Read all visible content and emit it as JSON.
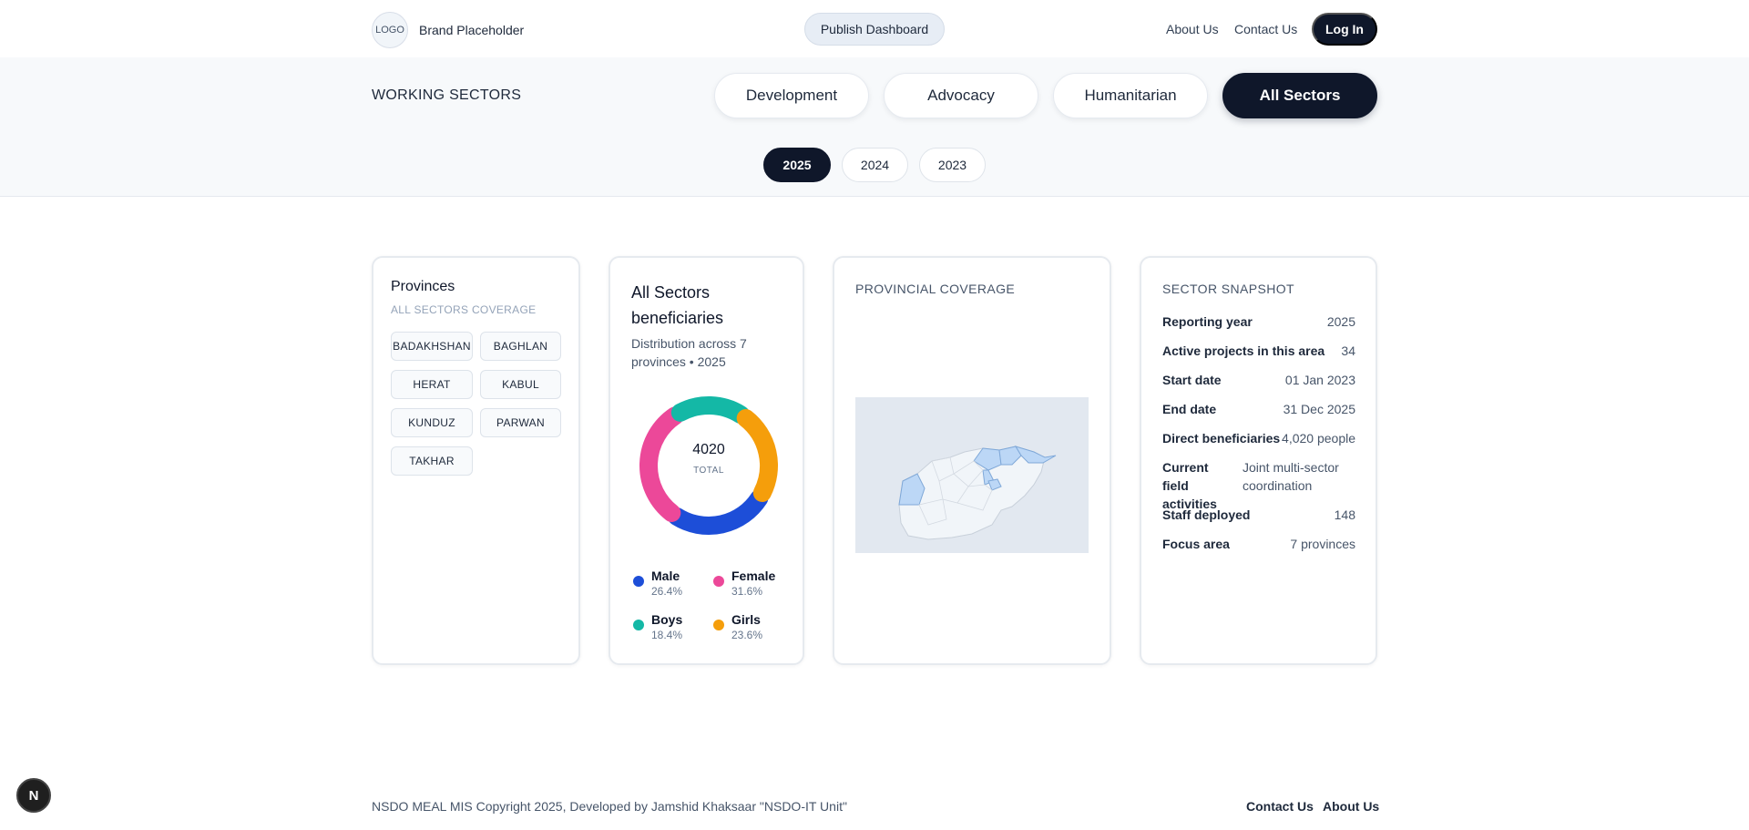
{
  "header": {
    "logo_text": "LOGO",
    "brand_name": "Brand Placeholder",
    "publish_label": "Publish Dashboard",
    "nav": {
      "about": "About Us",
      "contact": "Contact Us"
    },
    "login_label": "Log In"
  },
  "sectors": {
    "title": "WORKING SECTORS",
    "buttons": [
      "Development",
      "Advocacy",
      "Humanitarian",
      "All Sectors"
    ],
    "active": "All Sectors"
  },
  "years": {
    "buttons": [
      "2025",
      "2024",
      "2023"
    ],
    "active": "2025"
  },
  "provinces_card": {
    "title": "Provinces",
    "subtitle": "ALL SECTORS COVERAGE",
    "chips": [
      "BADAKHSHAN",
      "BAGHLAN",
      "HERAT",
      "KABUL",
      "KUNDUZ",
      "PARWAN",
      "TAKHAR"
    ]
  },
  "beneficiaries_card": {
    "title": "All Sectors beneficiaries",
    "subtitle": "Distribution across 7 provinces • 2025",
    "total": "4020",
    "total_label": "TOTAL",
    "legend": [
      {
        "name": "Male",
        "pct": "26.4%",
        "color": "#1d4ed8"
      },
      {
        "name": "Female",
        "pct": "31.6%",
        "color": "#ec4899"
      },
      {
        "name": "Boys",
        "pct": "18.4%",
        "color": "#14b8a6"
      },
      {
        "name": "Girls",
        "pct": "23.6%",
        "color": "#f59e0b"
      }
    ]
  },
  "chart_data": {
    "type": "pie",
    "categories": [
      "Male",
      "Female",
      "Boys",
      "Girls"
    ],
    "values": [
      26.4,
      31.6,
      18.4,
      23.6
    ],
    "total": 4020,
    "colors": [
      "#1d4ed8",
      "#ec4899",
      "#14b8a6",
      "#f59e0b"
    ]
  },
  "map_card": {
    "title": "PROVINCIAL COVERAGE"
  },
  "snapshot_card": {
    "title": "SECTOR SNAPSHOT",
    "rows": [
      {
        "label": "Reporting year",
        "value": "2025"
      },
      {
        "label": "Active projects in this area",
        "value": "34"
      },
      {
        "label": "Start date",
        "value": "01 Jan 2023"
      },
      {
        "label": "End date",
        "value": "31 Dec 2025"
      },
      {
        "label": "Direct beneficiaries",
        "value": "4,020 people"
      },
      {
        "label": "Current field activities",
        "value": "Joint multi-sector coordination"
      },
      {
        "label": "Staff deployed",
        "value": "148"
      },
      {
        "label": "Focus area",
        "value": "7 provinces"
      }
    ]
  },
  "footer": {
    "copyright": "NSDO MEAL MIS Copyright 2025, Developed by Jamshid Khaksaar \"NSDO-IT Unit\"",
    "contact": "Contact Us",
    "about": "About Us"
  },
  "dev_badge": "N"
}
